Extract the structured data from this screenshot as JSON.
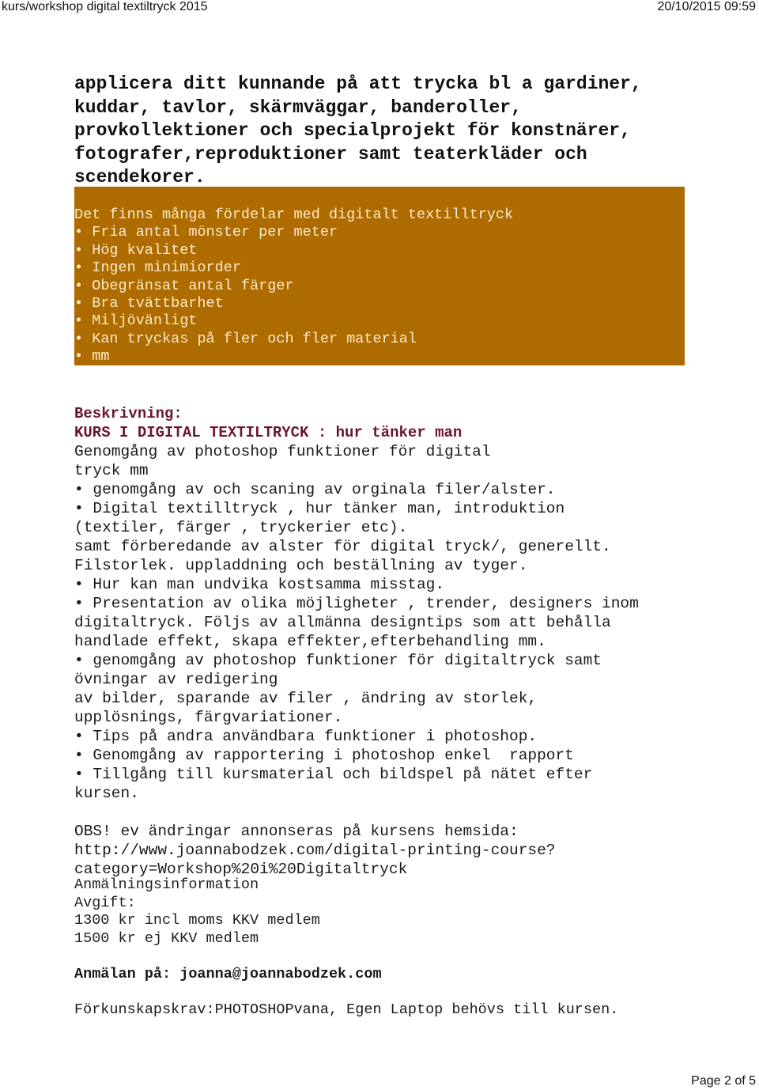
{
  "header": {
    "title": "kurs/workshop digital textiltryck 2015",
    "datetime": "20/10/2015 09:59"
  },
  "intro": {
    "lines": [
      "applicera ditt kunnande på att trycka bl a gardiner,",
      "kuddar, tavlor, skärmväggar, banderoller,",
      "provkollektioner och specialprojekt för konstnärer,",
      "fotografer,reproduktioner samt teaterkläder och",
      "scendekorer."
    ]
  },
  "benefits_box": {
    "bg_color": "#AD6B00",
    "heading": "Det finns många fördelar med digitalt textilltryck",
    "bullet": "•",
    "items": [
      "Fria antal mönster per meter",
      "Hög kvalitet",
      "Ingen minimiorder",
      "Obegränsat antal färger",
      "Bra tvättbarhet",
      "Miljövänligt",
      "Kan tryckas på fler och fler material",
      "mm"
    ]
  },
  "description": {
    "label": "Beskrivning:",
    "course_title": "KURS I DIGITAL TEXTILTRYCK : hur tänker man",
    "lines": [
      "Genomgång av photoshop funktioner för digital",
      "tryck mm",
      "• genomgång av och scaning av orginala filer/alster.",
      "• Digital textilltryck , hur tänker man, introduktion",
      "(textiler, färger , tryckerier etc).",
      "samt förberedande av alster för digital tryck/, generellt.",
      "Filstorlek. uppladdning och beställning av tyger.",
      "• Hur kan man undvika kostsamma misstag.",
      "• Presentation av olika möjligheter , trender, designers inom",
      "digitaltryck. Följs av allmänna designtips som att behålla",
      "handlade effekt, skapa effekter,efterbehandling mm.",
      "• genomgång av photoshop funktioner för digitaltryck samt",
      "övningar av redigering",
      "av bilder, sparande av filer , ändring av storlek,",
      "upplösnings, färgvariationer.",
      "• Tips på andra användbara funktioner i photoshop.",
      "• Genomgång av rapportering i photoshop enkel  rapport",
      "• Tillgång till kursmaterial och bildspel på nätet efter",
      "kursen."
    ]
  },
  "notice": {
    "lines": [
      "OBS! ev ändringar annonseras på kursens hemsida:",
      "http://www.joannabodzek.com/digital-printing-course?",
      "category=Workshop%20i%20Digitaltryck"
    ]
  },
  "registration": {
    "info_label": "Anmälningsinformation",
    "fee_label": "Avgift:",
    "fees": [
      "1300 kr incl moms KKV medlem",
      "1500 kr ej KKV medlem"
    ],
    "signup": "Anmälan på: joanna@joannabodzek.com",
    "prerequisites": "Förkunskapskrav:PHOTOSHOPvana, Egen Laptop behövs till kursen."
  },
  "footer": {
    "page_indicator": "Page 2 of 5"
  },
  "colors": {
    "box_bg": "#AD6B00",
    "box_text": "#FDEBC8",
    "heading_maroon": "#6B1535"
  }
}
